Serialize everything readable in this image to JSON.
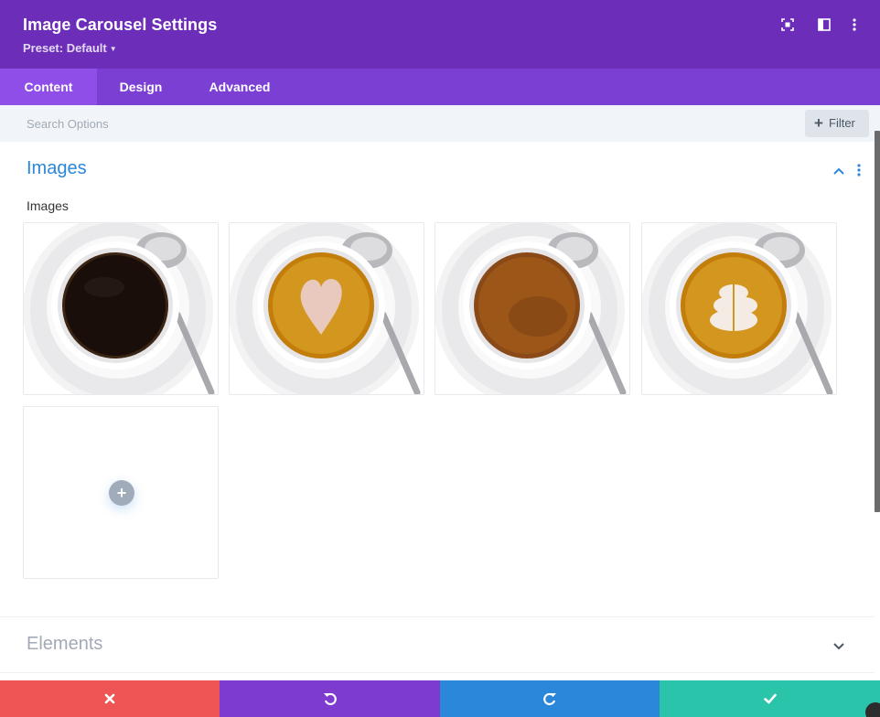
{
  "header": {
    "title": "Image Carousel Settings",
    "preset_label": "Preset: Default",
    "icons": [
      "fullscreen-icon",
      "split-view-icon",
      "more-vertical-icon"
    ]
  },
  "tabs": [
    {
      "label": "Content",
      "active": true
    },
    {
      "label": "Design",
      "active": false
    },
    {
      "label": "Advanced",
      "active": false
    }
  ],
  "search": {
    "placeholder": "Search Options",
    "value": "",
    "filter_label": "Filter"
  },
  "sections": {
    "images": {
      "title": "Images",
      "expanded": true,
      "field_label": "Images",
      "images": [
        {
          "content": "black coffee"
        },
        {
          "content": "latte heart art"
        },
        {
          "content": "coffee crema"
        },
        {
          "content": "latte leaf art"
        }
      ]
    },
    "elements": {
      "title": "Elements",
      "expanded": false
    }
  },
  "footer": {
    "buttons": [
      {
        "action": "discard",
        "icon": "close-icon",
        "color": "#ef5555"
      },
      {
        "action": "undo",
        "icon": "undo-icon",
        "color": "#7e3bd0"
      },
      {
        "action": "redo",
        "icon": "redo-icon",
        "color": "#2b87da"
      },
      {
        "action": "save",
        "icon": "check-icon",
        "color": "#29c4a9"
      }
    ]
  },
  "colors": {
    "header_bg": "#6c2eb9",
    "tabs_bg": "#7b40d3",
    "active_tab_bg": "#8f4ee8",
    "accent_blue": "#2b87da"
  }
}
